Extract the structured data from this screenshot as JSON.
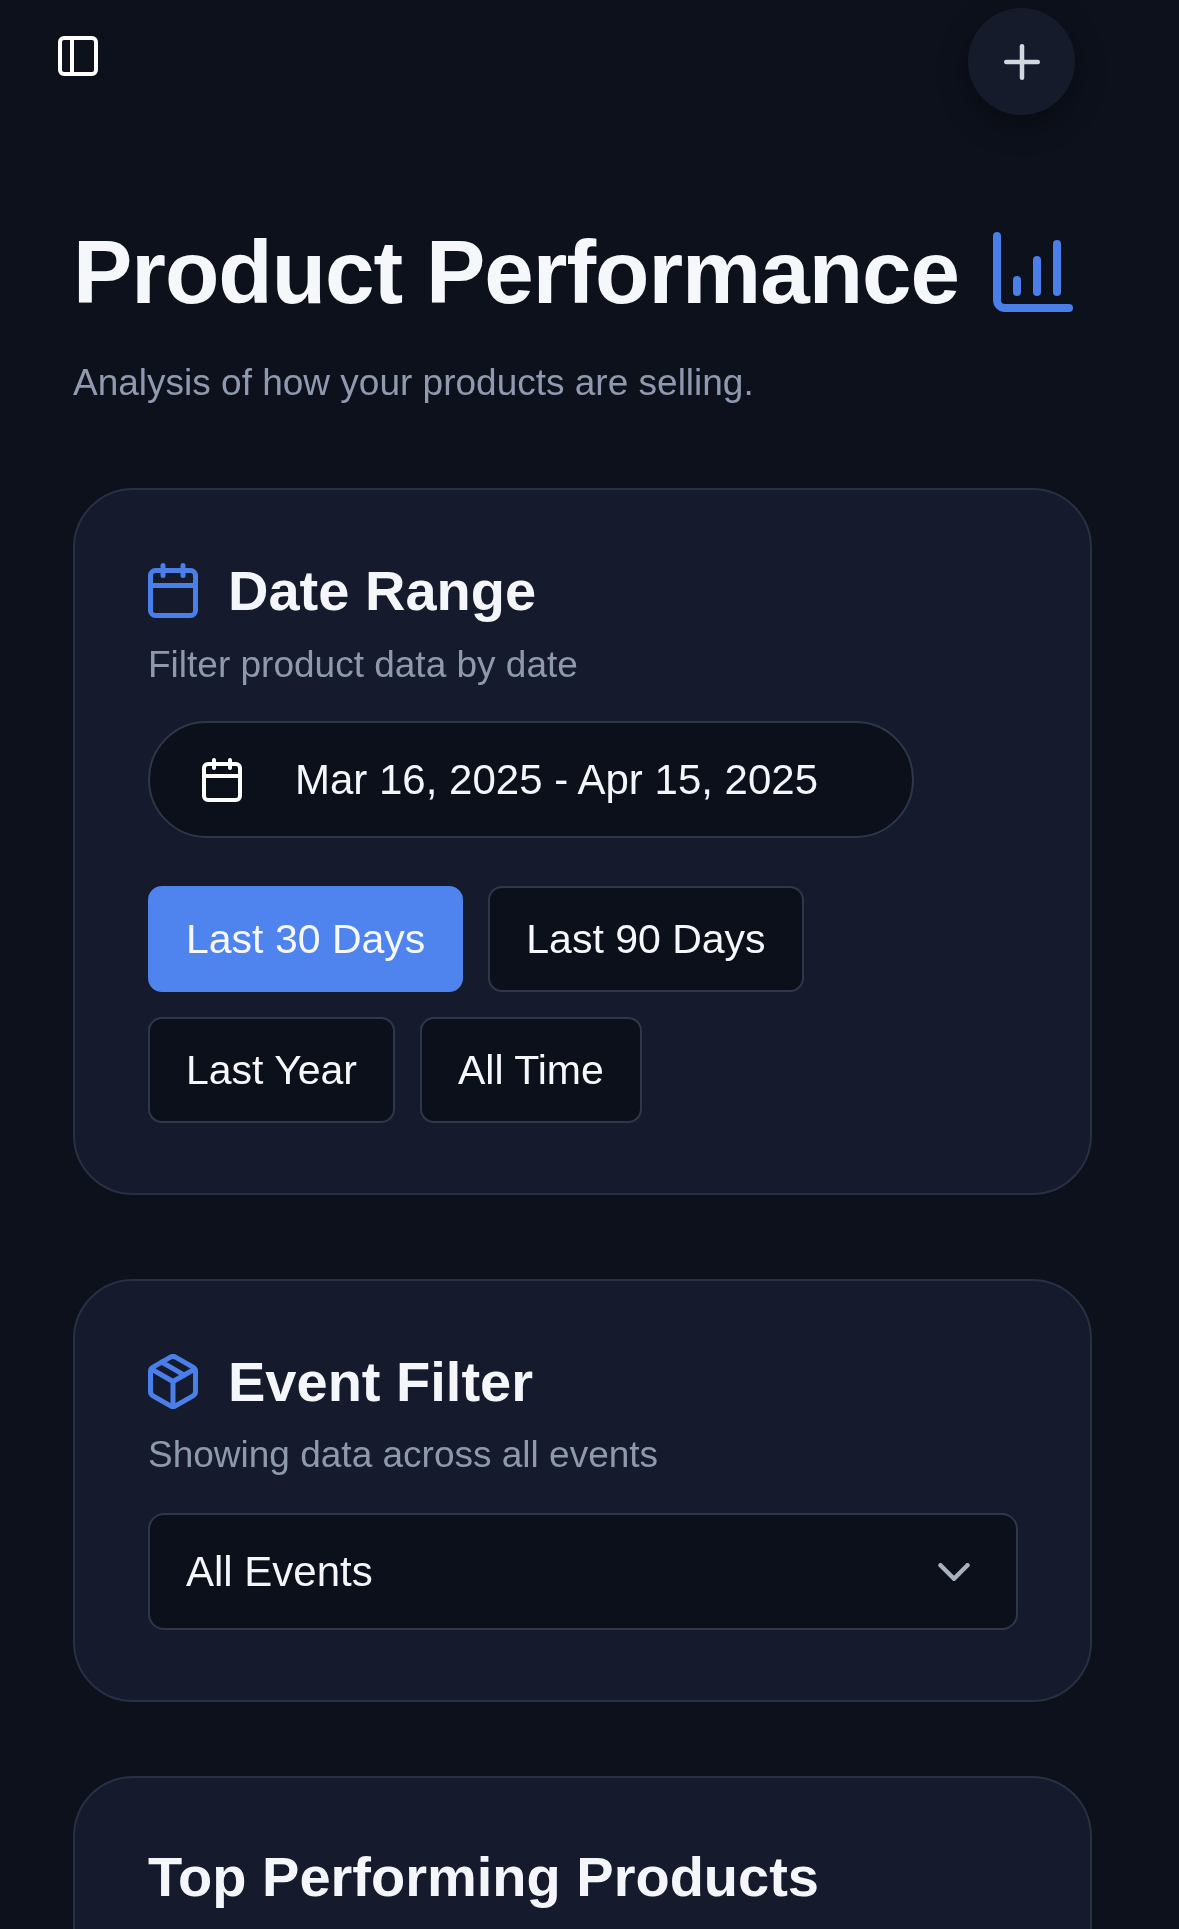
{
  "header": {
    "title": "Product Performance",
    "subtitle": "Analysis of how your products are selling."
  },
  "date_range_card": {
    "title": "Date Range",
    "subtitle": "Filter product data by date",
    "date_picker": {
      "value": "Mar 16, 2025 - Apr 15, 2025"
    },
    "presets": [
      {
        "label": "Last 30 Days",
        "selected": true
      },
      {
        "label": "Last 90 Days",
        "selected": false
      },
      {
        "label": "Last Year",
        "selected": false
      },
      {
        "label": "All Time",
        "selected": false
      }
    ]
  },
  "event_filter_card": {
    "title": "Event Filter",
    "subtitle": "Showing data across all events",
    "select": {
      "value": "All Events"
    }
  },
  "top_products_card": {
    "title": "Top Performing Products"
  }
}
